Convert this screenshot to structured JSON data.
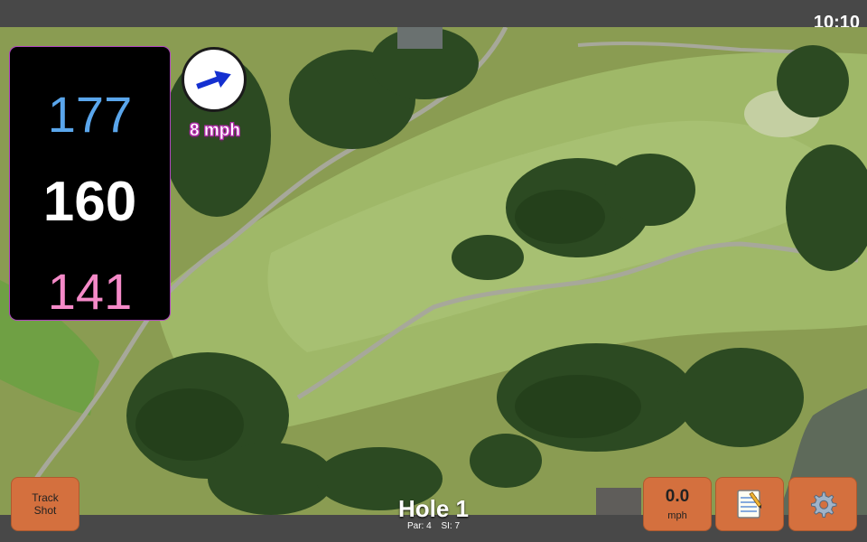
{
  "status_bar": {
    "time": "10:10"
  },
  "distances": {
    "back": "177",
    "middle": "160",
    "front": "141"
  },
  "wind": {
    "speed_label": "8 mph",
    "direction": "east-northeast"
  },
  "hole": {
    "title": "Hole 1",
    "par_label": "Par: 4",
    "si_label": "SI: 7"
  },
  "buttons": {
    "track_shot_line1": "Track",
    "track_shot_line2": "Shot",
    "speed_value": "0.0",
    "speed_unit": "mph",
    "notes_icon": "notepad-icon",
    "settings_icon": "gear-icon"
  },
  "colors": {
    "back_distance": "#5aa6ec",
    "middle_distance": "#ffffff",
    "front_distance": "#f58ac8",
    "button": "#d4703e",
    "wind_label_outline": "#b22cab"
  }
}
